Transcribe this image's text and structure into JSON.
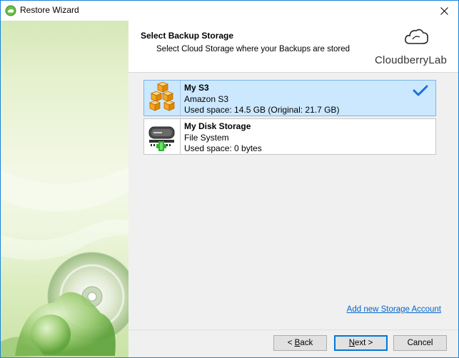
{
  "window": {
    "title": "Restore Wizard",
    "close_icon": "close-icon"
  },
  "header": {
    "title": "Select Backup Storage",
    "subtitle": "Select Cloud Storage where your Backups are stored",
    "logo_text": "CloudberryLab"
  },
  "storages": [
    {
      "name": "My S3",
      "type": "Amazon S3",
      "used": "Used space: 14.5 GB (Original: 21.7 GB)",
      "selected": true,
      "icon": "amazon-s3-cubes-icon"
    },
    {
      "name": "My Disk Storage",
      "type": "File System",
      "used": "Used space: 0 bytes",
      "selected": false,
      "icon": "hard-disk-icon"
    }
  ],
  "add_storage_link": "Add new Storage Account",
  "buttons": {
    "back_prefix": "< ",
    "back_accel": "B",
    "back_rest": "ack",
    "next_accel": "N",
    "next_rest": "ext >",
    "cancel": "Cancel"
  },
  "colors": {
    "accent": "#0078d7",
    "selected_bg": "#cce8ff",
    "link": "#0066cc",
    "cube": "#f5a623"
  }
}
